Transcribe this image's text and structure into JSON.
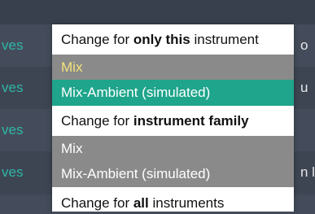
{
  "background": {
    "rows": [
      {
        "left": "ves",
        "right": "o"
      },
      {
        "left": "ves",
        "right": "u"
      },
      {
        "left": "ves",
        "right": ""
      },
      {
        "left": "ves",
        "right": "n l"
      }
    ]
  },
  "menu": {
    "sections": [
      {
        "header_prefix": "Change for ",
        "header_bold": "only this",
        "header_suffix": " instrument",
        "options": [
          "Mix",
          "Mix-Ambient (simulated)"
        ],
        "selected_index": 1
      },
      {
        "header_prefix": "Change for ",
        "header_bold": "instrument family",
        "header_suffix": "",
        "options": [
          "Mix",
          "Mix-Ambient (simulated)"
        ]
      },
      {
        "header_prefix": "Change for ",
        "header_bold": "all",
        "header_suffix": " instruments"
      }
    ]
  },
  "colors": {
    "accent_teal": "#1ea58b",
    "highlight_yellow": "#f2e27a",
    "option_grey": "#8a8a8a",
    "background_text_teal": "#2fb6a6"
  }
}
